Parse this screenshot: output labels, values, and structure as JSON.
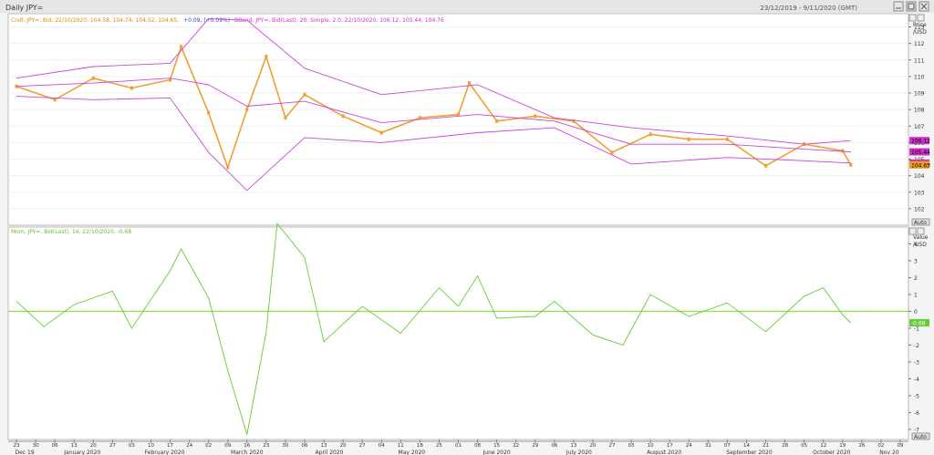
{
  "window": {
    "title": "Daily JPY=",
    "date_range": "23/12/2019 - 9/11/2020 (GMT)",
    "controls": [
      "-",
      "□",
      "×"
    ]
  },
  "price_panel": {
    "legend_candle": "Cndl, JPY=, Bid, 22/10/2020, 104.58, 104.74, 104.52, 104.65,",
    "legend_change": "+0.09, (+0.09%)",
    "legend_bband": "BBand, JPY=, Bid(Last), 20, Simple, 2.0, 22/10/2020, 106.12, 105.44, 104.76",
    "axis_title_1": "Price",
    "axis_title_2": "/USD",
    "auto_label": "Auto",
    "y_ticks": [
      102,
      103,
      104,
      105,
      106,
      107,
      108,
      109,
      110,
      111,
      112,
      113
    ],
    "last_labels": [
      {
        "text": "106.12",
        "value": 106.12,
        "color": "#cc33cc"
      },
      {
        "text": "105.44",
        "value": 105.44,
        "color": "#cc33cc"
      },
      {
        "text": "104.76",
        "value": 104.76,
        "color": "#cc33cc"
      },
      {
        "text": "104.65",
        "value": 104.65,
        "color": "#f0a020"
      }
    ]
  },
  "mom_panel": {
    "legend": "Mom, JPY=, Bid(Last), 14, 22/10/2020, -0.68",
    "axis_title_1": "Value",
    "axis_title_2": "/USD",
    "auto_label": "Auto",
    "y_ticks": [
      -7,
      -6,
      -5,
      -4,
      -3,
      -2,
      -1,
      0,
      1,
      2,
      3,
      4
    ],
    "last_label": {
      "text": "-0.68",
      "value": -0.68
    }
  },
  "x_axis": {
    "day_ticks": [
      "23",
      "30",
      "06",
      "13",
      "20",
      "27",
      "03",
      "10",
      "17",
      "24",
      "02",
      "09",
      "16",
      "23",
      "30",
      "06",
      "13",
      "20",
      "27",
      "04",
      "11",
      "18",
      "25",
      "01",
      "08",
      "15",
      "22",
      "29",
      "06",
      "13",
      "20",
      "27",
      "03",
      "10",
      "17",
      "24",
      "31",
      "07",
      "14",
      "21",
      "28",
      "05",
      "12",
      "19",
      "26",
      "02",
      "09"
    ],
    "month_labels": [
      "Dec 19",
      "January 2020",
      "February 2020",
      "March 2020",
      "April 2020",
      "May 2020",
      "June 2020",
      "July 2020",
      "August 2020",
      "September 2020",
      "October 2020",
      "Nov 20"
    ]
  },
  "colors": {
    "candle_up": "#f0a030",
    "candle_down": "#f0a030",
    "bband": "#cc44dd",
    "momentum": "#66cc33",
    "zero_line": "#99dd55",
    "axis_text": "#333333"
  },
  "chart_data": [
    {
      "type": "line",
      "title": "Daily JPY=",
      "series": [
        {
          "name": "Cndl, JPY=, Bid",
          "x": [
            "2019-12-23",
            "2020-01-06",
            "2020-01-20",
            "2020-02-03",
            "2020-02-17",
            "2020-02-21",
            "2020-03-02",
            "2020-03-09",
            "2020-03-16",
            "2020-03-23",
            "2020-03-30",
            "2020-04-06",
            "2020-04-20",
            "2020-05-04",
            "2020-05-18",
            "2020-06-01",
            "2020-06-05",
            "2020-06-15",
            "2020-06-29",
            "2020-07-13",
            "2020-07-27",
            "2020-08-10",
            "2020-08-24",
            "2020-09-07",
            "2020-09-21",
            "2020-10-05",
            "2020-10-19",
            "2020-10-22"
          ],
          "values": [
            109.4,
            108.6,
            109.9,
            109.3,
            109.8,
            111.8,
            107.8,
            104.5,
            108.0,
            111.2,
            107.5,
            108.9,
            107.6,
            106.6,
            107.5,
            107.7,
            109.6,
            107.3,
            107.6,
            107.3,
            105.4,
            106.5,
            106.2,
            106.2,
            104.6,
            105.9,
            105.5,
            104.65
          ]
        },
        {
          "name": "BBand, JPY=, Bid(Last), 20, Simple, 2.0 (upper)",
          "x": [
            "2019-12-23",
            "2020-01-20",
            "2020-02-17",
            "2020-03-02",
            "2020-03-16",
            "2020-04-06",
            "2020-05-04",
            "2020-06-08",
            "2020-07-06",
            "2020-08-03",
            "2020-09-07",
            "2020-10-05",
            "2020-10-22"
          ],
          "values": [
            109.9,
            110.6,
            110.8,
            113.5,
            113.4,
            110.5,
            108.9,
            109.5,
            107.5,
            106.9,
            106.4,
            105.9,
            106.12
          ]
        },
        {
          "name": "BBand, JPY=, Bid(Last), 20, Simple, 2.0 (middle)",
          "x": [
            "2019-12-23",
            "2020-01-20",
            "2020-02-17",
            "2020-03-02",
            "2020-03-16",
            "2020-04-06",
            "2020-05-04",
            "2020-06-08",
            "2020-07-06",
            "2020-08-03",
            "2020-09-07",
            "2020-10-05",
            "2020-10-22"
          ],
          "values": [
            109.4,
            109.6,
            109.9,
            109.5,
            108.2,
            108.5,
            107.2,
            107.7,
            107.3,
            105.9,
            105.9,
            105.6,
            105.44
          ]
        },
        {
          "name": "BBand, JPY=, Bid(Last), 20, Simple, 2.0 (lower)",
          "x": [
            "2019-12-23",
            "2020-01-20",
            "2020-02-17",
            "2020-03-02",
            "2020-03-16",
            "2020-04-06",
            "2020-05-04",
            "2020-06-08",
            "2020-07-06",
            "2020-08-03",
            "2020-09-07",
            "2020-10-05",
            "2020-10-22"
          ],
          "values": [
            108.8,
            108.6,
            108.7,
            105.4,
            103.1,
            106.3,
            106.0,
            106.6,
            106.9,
            104.7,
            105.1,
            104.9,
            104.76
          ]
        }
      ],
      "ylabel": "Price /USD",
      "ylim": [
        101.0,
        113.8
      ]
    },
    {
      "type": "line",
      "series": [
        {
          "name": "Mom, JPY=, Bid(Last), 14",
          "x": [
            "2019-12-23",
            "2020-01-02",
            "2020-01-13",
            "2020-01-27",
            "2020-02-03",
            "2020-02-17",
            "2020-02-21",
            "2020-03-02",
            "2020-03-09",
            "2020-03-16",
            "2020-03-23",
            "2020-03-27",
            "2020-04-06",
            "2020-04-13",
            "2020-04-27",
            "2020-05-11",
            "2020-05-25",
            "2020-06-01",
            "2020-06-08",
            "2020-06-15",
            "2020-06-29",
            "2020-07-06",
            "2020-07-20",
            "2020-07-31",
            "2020-08-10",
            "2020-08-24",
            "2020-09-07",
            "2020-09-21",
            "2020-10-05",
            "2020-10-12",
            "2020-10-19",
            "2020-10-22"
          ],
          "values": [
            0.6,
            -0.9,
            0.4,
            1.2,
            -1.0,
            2.4,
            3.7,
            0.8,
            -3.5,
            -7.3,
            -1.2,
            5.2,
            3.2,
            -1.8,
            0.3,
            -1.3,
            1.4,
            0.3,
            2.1,
            -0.4,
            -0.3,
            0.6,
            -1.4,
            -2.0,
            1.0,
            -0.3,
            0.5,
            -1.2,
            0.9,
            1.4,
            -0.2,
            -0.68
          ]
        }
      ],
      "ylabel": "Value /USD",
      "ylim": [
        -7.6,
        5.0
      ]
    }
  ]
}
